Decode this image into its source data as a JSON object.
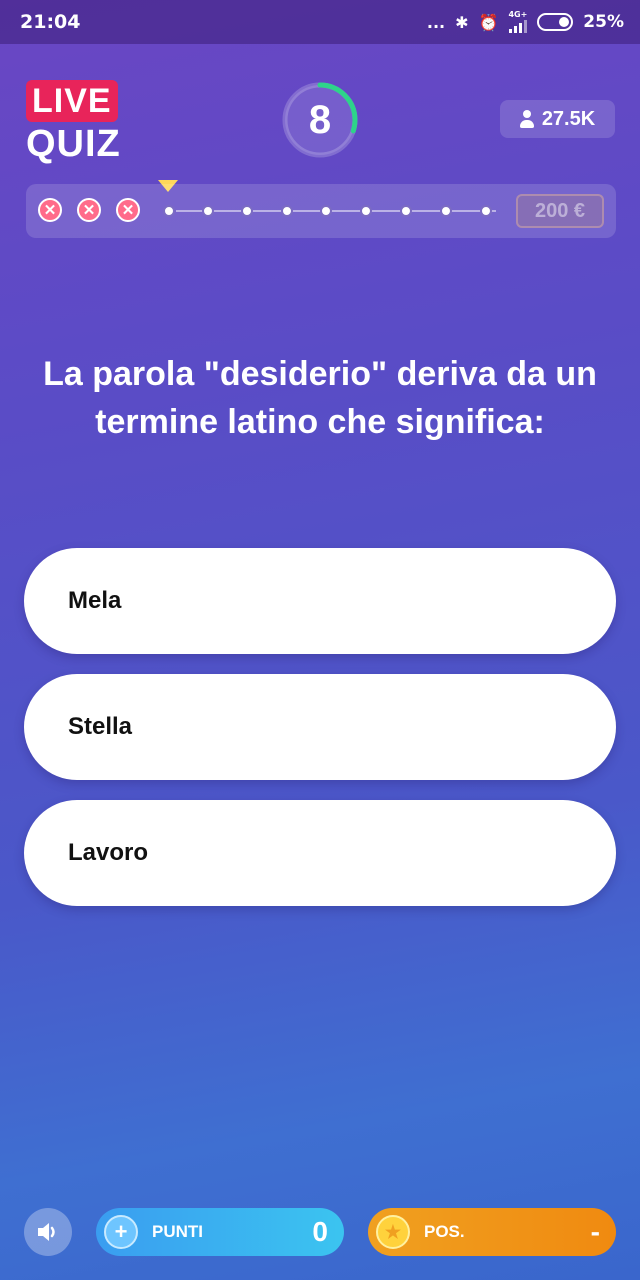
{
  "status_bar": {
    "time": "21:04",
    "dots": "...",
    "network": "4G+",
    "battery": "25%"
  },
  "logo": {
    "live": "LIVE",
    "quiz": "QUIZ"
  },
  "timer": {
    "seconds": "8",
    "remaining_fraction": 0.3,
    "ring_color": "#2ed38a"
  },
  "viewers": {
    "count": "27.5K"
  },
  "progress": {
    "wrong_answers": 3,
    "total_steps": 12,
    "prize": "200 €"
  },
  "question": {
    "text": "La parola \"desiderio\" deriva da un termine latino che significa:"
  },
  "answers": [
    {
      "label": "Mela"
    },
    {
      "label": "Stella"
    },
    {
      "label": "Lavoro"
    }
  ],
  "bottom": {
    "punti_label": "PUNTI",
    "punti_value": "0",
    "pos_label": "POS.",
    "pos_value": "-"
  },
  "colors": {
    "accent_red": "#e8245a",
    "punti_blue": "#3a9df0",
    "pos_orange": "#f0a020"
  }
}
